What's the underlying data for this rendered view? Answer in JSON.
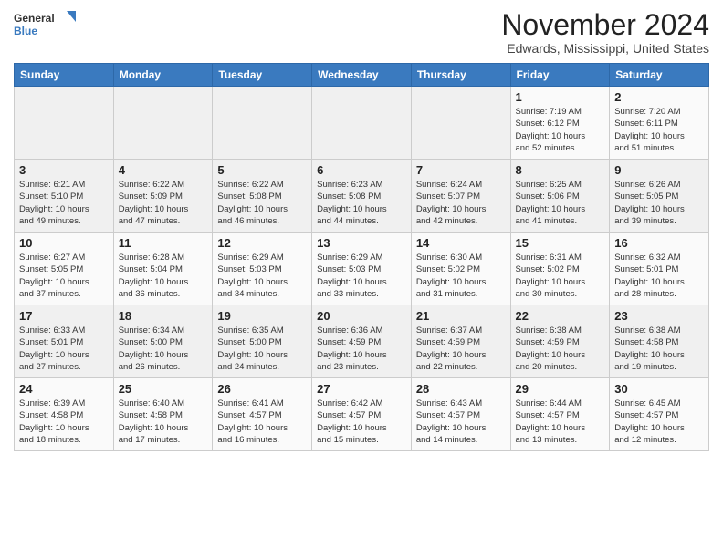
{
  "header": {
    "logo": {
      "general": "General",
      "blue": "Blue"
    },
    "title": "November 2024",
    "location": "Edwards, Mississippi, United States"
  },
  "weekdays": [
    "Sunday",
    "Monday",
    "Tuesday",
    "Wednesday",
    "Thursday",
    "Friday",
    "Saturday"
  ],
  "weeks": [
    [
      {
        "day": "",
        "info": ""
      },
      {
        "day": "",
        "info": ""
      },
      {
        "day": "",
        "info": ""
      },
      {
        "day": "",
        "info": ""
      },
      {
        "day": "",
        "info": ""
      },
      {
        "day": "1",
        "info": "Sunrise: 7:19 AM\nSunset: 6:12 PM\nDaylight: 10 hours\nand 52 minutes."
      },
      {
        "day": "2",
        "info": "Sunrise: 7:20 AM\nSunset: 6:11 PM\nDaylight: 10 hours\nand 51 minutes."
      }
    ],
    [
      {
        "day": "3",
        "info": "Sunrise: 6:21 AM\nSunset: 5:10 PM\nDaylight: 10 hours\nand 49 minutes."
      },
      {
        "day": "4",
        "info": "Sunrise: 6:22 AM\nSunset: 5:09 PM\nDaylight: 10 hours\nand 47 minutes."
      },
      {
        "day": "5",
        "info": "Sunrise: 6:22 AM\nSunset: 5:08 PM\nDaylight: 10 hours\nand 46 minutes."
      },
      {
        "day": "6",
        "info": "Sunrise: 6:23 AM\nSunset: 5:08 PM\nDaylight: 10 hours\nand 44 minutes."
      },
      {
        "day": "7",
        "info": "Sunrise: 6:24 AM\nSunset: 5:07 PM\nDaylight: 10 hours\nand 42 minutes."
      },
      {
        "day": "8",
        "info": "Sunrise: 6:25 AM\nSunset: 5:06 PM\nDaylight: 10 hours\nand 41 minutes."
      },
      {
        "day": "9",
        "info": "Sunrise: 6:26 AM\nSunset: 5:05 PM\nDaylight: 10 hours\nand 39 minutes."
      }
    ],
    [
      {
        "day": "10",
        "info": "Sunrise: 6:27 AM\nSunset: 5:05 PM\nDaylight: 10 hours\nand 37 minutes."
      },
      {
        "day": "11",
        "info": "Sunrise: 6:28 AM\nSunset: 5:04 PM\nDaylight: 10 hours\nand 36 minutes."
      },
      {
        "day": "12",
        "info": "Sunrise: 6:29 AM\nSunset: 5:03 PM\nDaylight: 10 hours\nand 34 minutes."
      },
      {
        "day": "13",
        "info": "Sunrise: 6:29 AM\nSunset: 5:03 PM\nDaylight: 10 hours\nand 33 minutes."
      },
      {
        "day": "14",
        "info": "Sunrise: 6:30 AM\nSunset: 5:02 PM\nDaylight: 10 hours\nand 31 minutes."
      },
      {
        "day": "15",
        "info": "Sunrise: 6:31 AM\nSunset: 5:02 PM\nDaylight: 10 hours\nand 30 minutes."
      },
      {
        "day": "16",
        "info": "Sunrise: 6:32 AM\nSunset: 5:01 PM\nDaylight: 10 hours\nand 28 minutes."
      }
    ],
    [
      {
        "day": "17",
        "info": "Sunrise: 6:33 AM\nSunset: 5:01 PM\nDaylight: 10 hours\nand 27 minutes."
      },
      {
        "day": "18",
        "info": "Sunrise: 6:34 AM\nSunset: 5:00 PM\nDaylight: 10 hours\nand 26 minutes."
      },
      {
        "day": "19",
        "info": "Sunrise: 6:35 AM\nSunset: 5:00 PM\nDaylight: 10 hours\nand 24 minutes."
      },
      {
        "day": "20",
        "info": "Sunrise: 6:36 AM\nSunset: 4:59 PM\nDaylight: 10 hours\nand 23 minutes."
      },
      {
        "day": "21",
        "info": "Sunrise: 6:37 AM\nSunset: 4:59 PM\nDaylight: 10 hours\nand 22 minutes."
      },
      {
        "day": "22",
        "info": "Sunrise: 6:38 AM\nSunset: 4:59 PM\nDaylight: 10 hours\nand 20 minutes."
      },
      {
        "day": "23",
        "info": "Sunrise: 6:38 AM\nSunset: 4:58 PM\nDaylight: 10 hours\nand 19 minutes."
      }
    ],
    [
      {
        "day": "24",
        "info": "Sunrise: 6:39 AM\nSunset: 4:58 PM\nDaylight: 10 hours\nand 18 minutes."
      },
      {
        "day": "25",
        "info": "Sunrise: 6:40 AM\nSunset: 4:58 PM\nDaylight: 10 hours\nand 17 minutes."
      },
      {
        "day": "26",
        "info": "Sunrise: 6:41 AM\nSunset: 4:57 PM\nDaylight: 10 hours\nand 16 minutes."
      },
      {
        "day": "27",
        "info": "Sunrise: 6:42 AM\nSunset: 4:57 PM\nDaylight: 10 hours\nand 15 minutes."
      },
      {
        "day": "28",
        "info": "Sunrise: 6:43 AM\nSunset: 4:57 PM\nDaylight: 10 hours\nand 14 minutes."
      },
      {
        "day": "29",
        "info": "Sunrise: 6:44 AM\nSunset: 4:57 PM\nDaylight: 10 hours\nand 13 minutes."
      },
      {
        "day": "30",
        "info": "Sunrise: 6:45 AM\nSunset: 4:57 PM\nDaylight: 10 hours\nand 12 minutes."
      }
    ]
  ]
}
